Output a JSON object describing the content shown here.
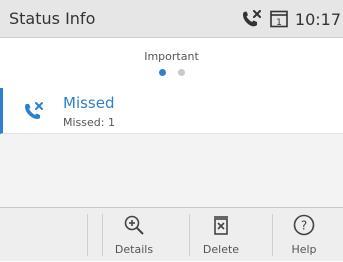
{
  "status_bar": {
    "title": "Status Info",
    "time": "10:17",
    "icons": [
      "missed-call-icon",
      "window-1-icon"
    ]
  },
  "page": {
    "label": "Important",
    "pages_total": 2,
    "page_active": 1,
    "accent_color": "#2f7fd1"
  },
  "list": {
    "items": [
      {
        "icon": "missed-call-icon",
        "title": "Missed",
        "subtitle": "Missed: 1"
      }
    ]
  },
  "softkeys": [
    {
      "label": "Details",
      "icon": "zoom-plus-icon"
    },
    {
      "label": "Delete",
      "icon": "trash-icon"
    },
    {
      "label": "Help",
      "icon": "help-circle-icon"
    }
  ]
}
